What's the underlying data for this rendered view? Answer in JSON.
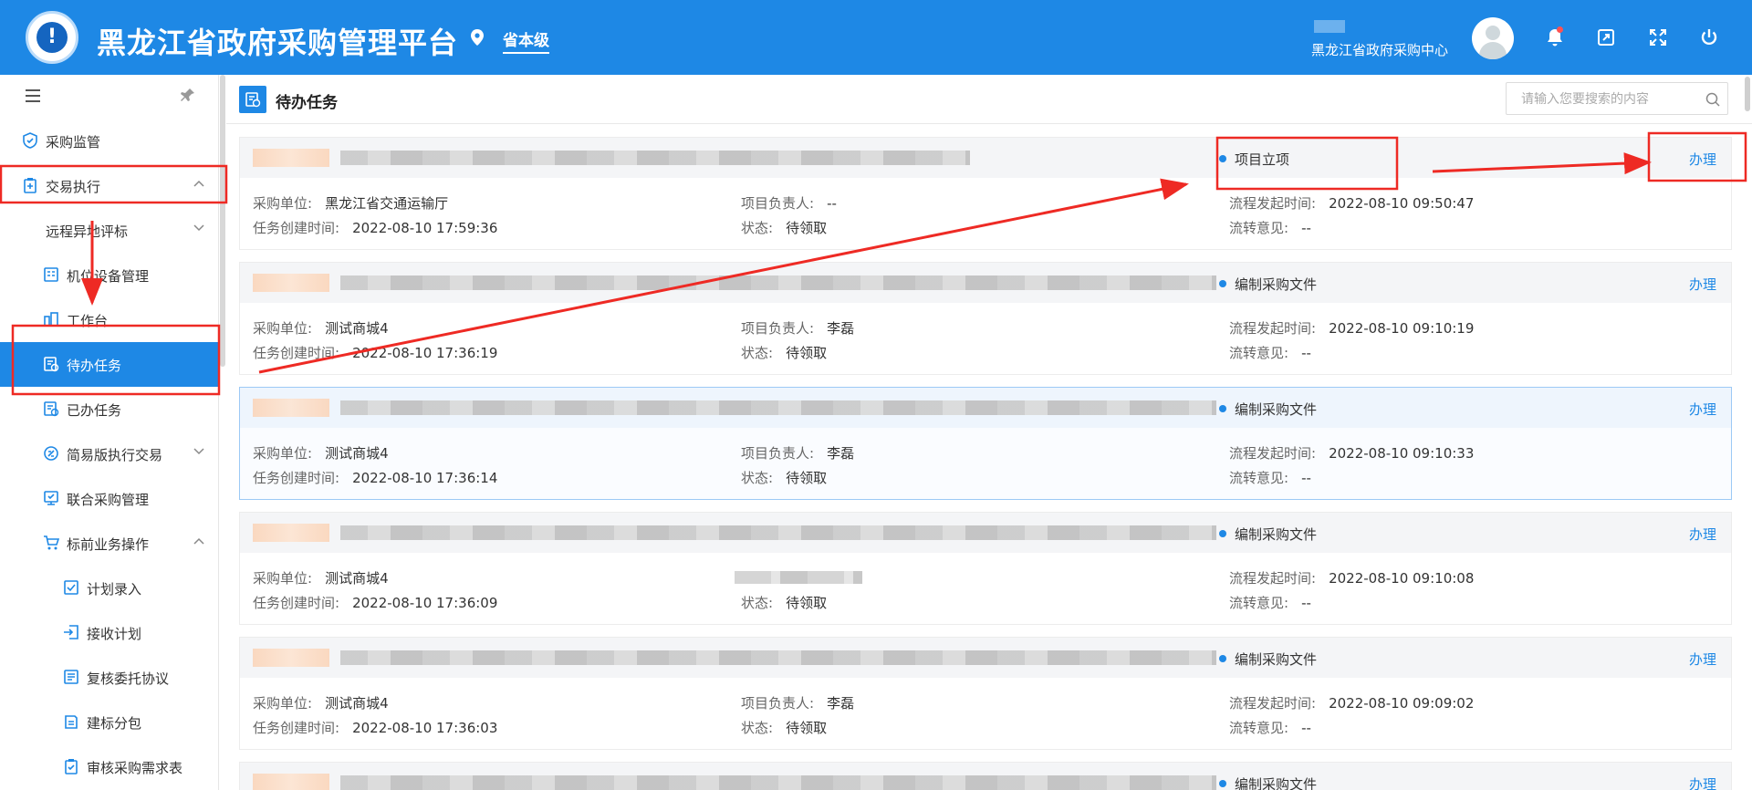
{
  "header": {
    "app_title": "黑龙江省政府采购管理平台",
    "location": "省本级",
    "org_name": "黑龙江省政府采购中心",
    "icons": [
      "bell-icon",
      "external-window-icon",
      "fullscreen-icon",
      "power-icon"
    ]
  },
  "sidebar": {
    "items": [
      {
        "label": "采购监管",
        "icon": "shield-icon"
      },
      {
        "label": "交易执行",
        "icon": "clipboard-icon",
        "expanded": true
      },
      {
        "label": "远程异地评标",
        "icon": ""
      },
      {
        "label": "机位设备管理",
        "icon": "device-icon"
      },
      {
        "label": "工作台",
        "icon": "workbench-icon"
      },
      {
        "label": "待办任务",
        "icon": "todo-icon",
        "active": true
      },
      {
        "label": "已办任务",
        "icon": "done-icon"
      },
      {
        "label": "简易版执行交易",
        "icon": "simple-trade-icon"
      },
      {
        "label": "联合采购管理",
        "icon": "joint-purchase-icon"
      },
      {
        "label": "标前业务操作",
        "icon": "cart-icon",
        "expanded": true
      },
      {
        "label": "计划录入",
        "icon": "plan-entry-icon"
      },
      {
        "label": "接收计划",
        "icon": "receive-plan-icon"
      },
      {
        "label": "复核委托协议",
        "icon": "agreement-icon"
      },
      {
        "label": "建标分包",
        "icon": "package-icon"
      },
      {
        "label": "审核采购需求表",
        "icon": "review-icon"
      }
    ]
  },
  "main": {
    "title": "待办任务",
    "search_placeholder": "请输入您要搜索的内容",
    "labels": {
      "unit": "采购单位:",
      "created": "任务创建时间:",
      "owner": "项目负责人:",
      "status": "状态:",
      "flow_start": "流程发起时间:",
      "opinion": "流转意见:",
      "handle": "办理"
    },
    "tasks": [
      {
        "stage": "项目立项",
        "unit": "黑龙江省交通运输厅",
        "created": "2022-08-10 17:59:36",
        "owner": "--",
        "status": "待领取",
        "flow_start": "2022-08-10 09:50:47",
        "opinion": "--"
      },
      {
        "stage": "编制采购文件",
        "unit": "测试商城4",
        "created": "2022-08-10 17:36:19",
        "owner": "李磊",
        "status": "待领取",
        "flow_start": "2022-08-10 09:10:19",
        "opinion": "--"
      },
      {
        "stage": "编制采购文件",
        "unit": "测试商城4",
        "created": "2022-08-10 17:36:14",
        "owner": "李磊",
        "status": "待领取",
        "flow_start": "2022-08-10 09:10:33",
        "opinion": "--"
      },
      {
        "stage": "编制采购文件",
        "unit": "测试商城4",
        "created": "2022-08-10 17:36:09",
        "owner": "",
        "status": "待领取",
        "flow_start": "2022-08-10 09:10:08",
        "opinion": "--"
      },
      {
        "stage": "编制采购文件",
        "unit": "测试商城4",
        "created": "2022-08-10 17:36:03",
        "owner": "李磊",
        "status": "待领取",
        "flow_start": "2022-08-10 09:09:02",
        "opinion": "--"
      },
      {
        "stage": "编制采购文件"
      }
    ]
  },
  "annotation_color": "#ee2a24"
}
